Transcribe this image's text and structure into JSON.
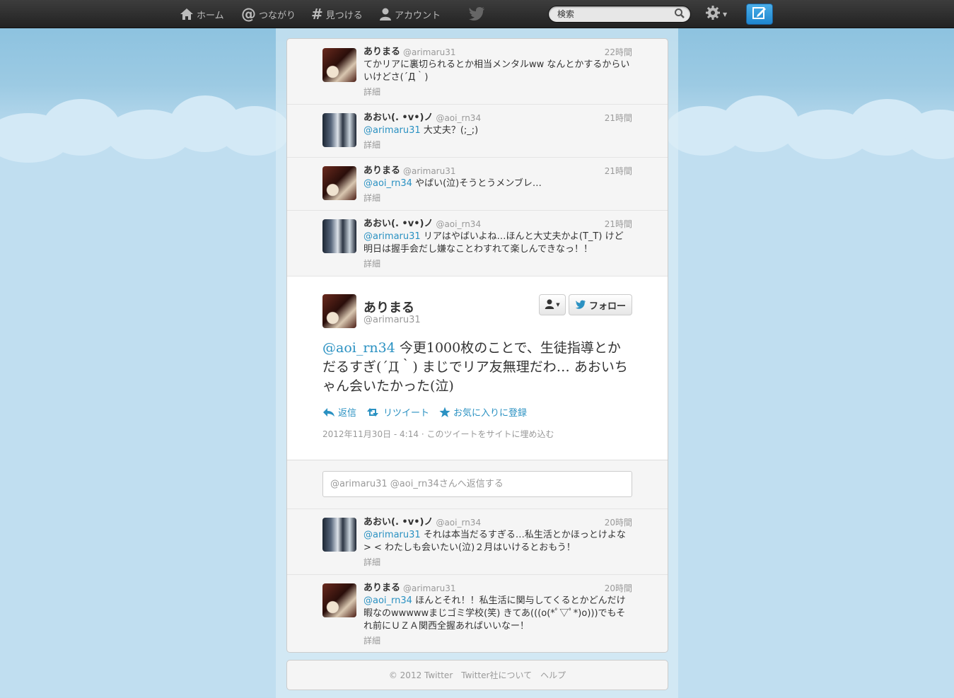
{
  "nav": {
    "home": "ホーム",
    "connect": "つながり",
    "discover": "見つける",
    "account": "アカウント",
    "search_placeholder": "検索"
  },
  "tweets_before": [
    {
      "avatar": "a",
      "name": "ありまる",
      "handle": "@arimaru31",
      "time": "22時間",
      "mention": "",
      "text": "てかリアに裏切られるとか相当メンタルww なんとかするからいいけどさ(´Д｀)",
      "detail": "詳細"
    },
    {
      "avatar": "b",
      "name": "あおい(. •v•)ノ",
      "handle": "@aoi_rn34",
      "time": "21時間",
      "mention": "@arimaru31",
      "text": " 大丈夫？(;_;)",
      "detail": "詳細"
    },
    {
      "avatar": "a",
      "name": "ありまる",
      "handle": "@arimaru31",
      "time": "21時間",
      "mention": "@aoi_rn34",
      "text": " やばい(泣)そうとうメンブレ…",
      "detail": "詳細"
    },
    {
      "avatar": "b",
      "name": "あおい(. •v•)ノ",
      "handle": "@aoi_rn34",
      "time": "21時間",
      "mention": "@arimaru31",
      "text": " リアはやばいよね…ほんと大丈夫かよ(T_T) けど明日は握手会だし嫌なことわすれて楽しんできなっ！！",
      "detail": "詳細"
    }
  ],
  "focused": {
    "name": "ありまる",
    "handle": "@arimaru31",
    "follow_label": "フォロー",
    "mention": "@aoi_rn34",
    "text": " 今更1000枚のことで、生徒指導とかだるすぎ(´Д｀) まじでリア友無理だわ… あおいちゃん会いたかった(泣)",
    "reply": "返信",
    "retweet": "リツイート",
    "favorite": "お気に入りに登録",
    "timestamp": "2012年11月30日 - 4:14",
    "embed": "このツイートをサイトに埋め込む"
  },
  "reply_box": {
    "placeholder": "@arimaru31 @aoi_rn34さんへ返信する"
  },
  "tweets_after": [
    {
      "avatar": "b",
      "name": "あおい(. •v•)ノ",
      "handle": "@aoi_rn34",
      "time": "20時間",
      "mention": "@arimaru31",
      "text": " それは本当だるすぎる…私生活とかほっとけよな> < わたしも会いたい(泣)２月はいけるとおもう！",
      "detail": "詳細"
    },
    {
      "avatar": "a",
      "name": "ありまる",
      "handle": "@arimaru31",
      "time": "20時間",
      "mention": "@aoi_rn34",
      "text": " ほんとそれ！！私生活に関与してくるとかどんだけ暇なのwwwwwまじゴミ学校(笑) きてあ(((o(*ﾟ▽ﾟ*)o)))でもそれ前にＵＺＡ関西全握あればいいなー！",
      "detail": "詳細"
    }
  ],
  "footer": {
    "copyright": "© 2012 Twitter",
    "about": "Twitter社について",
    "help": "ヘルプ"
  },
  "colors": {
    "link": "#2a91c2",
    "topbar": "#2b2b2b",
    "sky": "#c0def0"
  }
}
